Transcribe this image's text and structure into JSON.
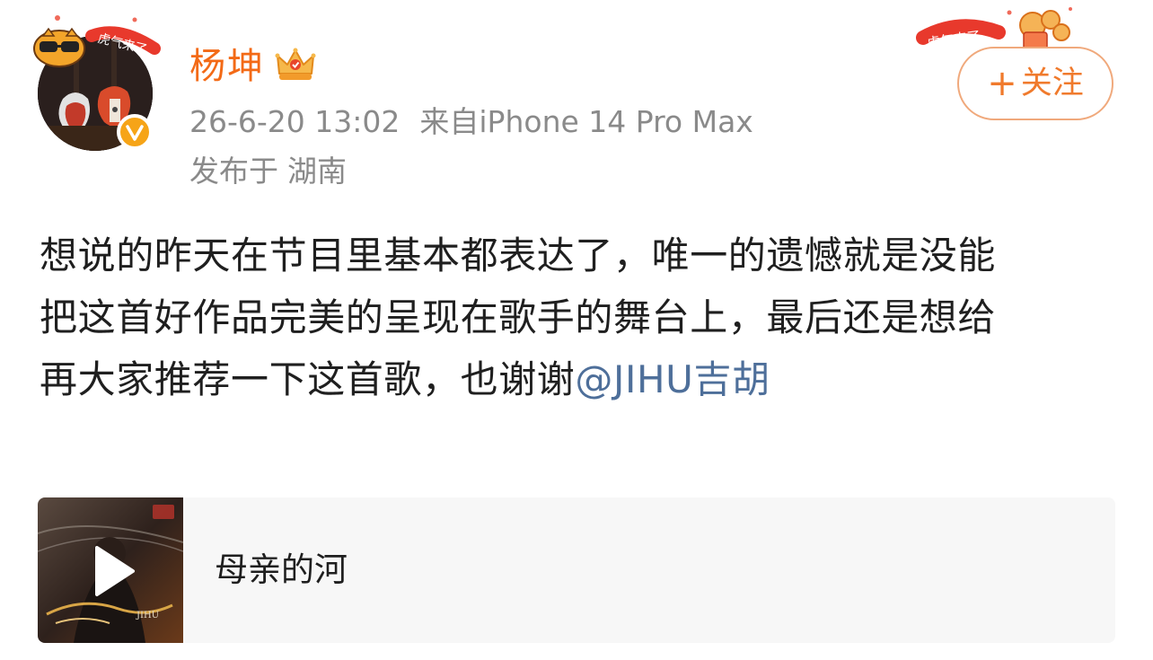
{
  "author": {
    "name": "杨坤",
    "crown_icon": "vip-crown-icon",
    "verified_icon": "verified-v-icon",
    "avatar_frame_text": "虎气来了"
  },
  "meta": {
    "timestamp": "26-6-20 13:02",
    "source": "来自iPhone 14 Pro Max",
    "location_prefix": "发布于",
    "location": "湖南"
  },
  "follow": {
    "plus": "+",
    "label": "关注",
    "decoration_text": "虎气来了"
  },
  "post": {
    "lines": [
      "想说的昨天在节目里基本都表达了，唯一的遗憾就是没能",
      "把这首好作品完美的呈现在歌手的舞台上，最后还是想给",
      "再大家推荐一下这首歌，也谢谢"
    ],
    "mention": "@JIHU吉胡"
  },
  "music_card": {
    "song_title": "母亲的河",
    "play_icon": "play-icon",
    "cover_artist": "JIHU"
  },
  "colors": {
    "author_name": "#f36a16",
    "meta_text": "#8a8a8a",
    "follow_accent": "#f07a2c",
    "mention": "#4e6f9a",
    "card_bg": "#f7f7f7",
    "verified_badge": "#f6a417"
  }
}
